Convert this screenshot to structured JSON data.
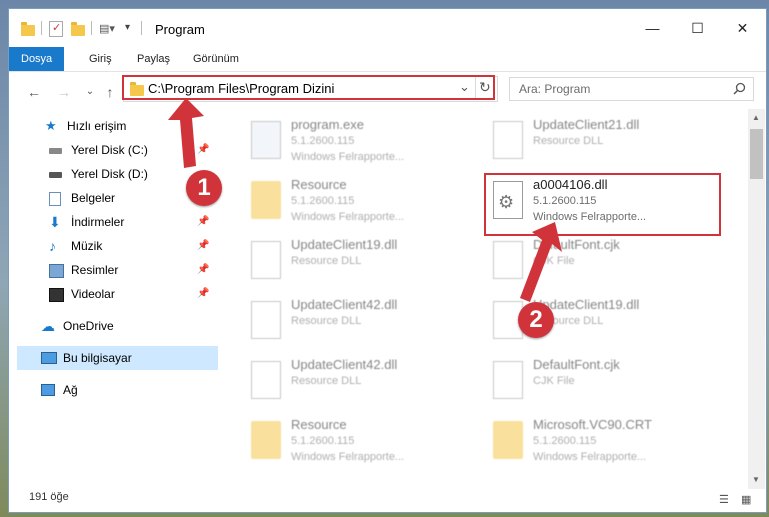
{
  "window": {
    "title": "Program",
    "minimize": "—",
    "maximize": "☐",
    "close": "✕"
  },
  "ribbon": {
    "tabs": [
      "Dosya",
      "Giriş",
      "Paylaş",
      "Görünüm"
    ],
    "active_tab": "Dosya"
  },
  "address": {
    "path": "C:\\Program Files\\Program Dizini",
    "back": "←",
    "forward": "→",
    "dropdown": "⌄",
    "up": "↑",
    "refresh": "↻"
  },
  "search": {
    "placeholder": "Ara: Program",
    "icon": "search-icon"
  },
  "nav": {
    "quick_access": "Hızlı erişim",
    "items": [
      {
        "label": "Yerel Disk (C:)",
        "icon": "drive-icon",
        "pinned": true
      },
      {
        "label": "Yerel Disk (D:)",
        "icon": "drive-icon",
        "pinned": false
      },
      {
        "label": "Belgeler",
        "icon": "documents-icon",
        "pinned": true
      },
      {
        "label": "İndirmeler",
        "icon": "download-icon",
        "pinned": true
      },
      {
        "label": "Müzik",
        "icon": "music-icon",
        "pinned": true
      },
      {
        "label": "Resimler",
        "icon": "pictures-icon",
        "pinned": true
      },
      {
        "label": "Videolar",
        "icon": "videos-icon",
        "pinned": true
      }
    ],
    "onedrive": "OneDrive",
    "this_pc": "Bu bilgisayar",
    "network": "Ağ"
  },
  "files": [
    {
      "name": "program.exe",
      "line1": "5.1.2600.115",
      "line2": "Windows Felrapporte...",
      "kind": "exe"
    },
    {
      "name": "UpdateClient21.dll",
      "line1": "Resource DLL",
      "line2": "",
      "kind": "doc"
    },
    {
      "name": "Resource",
      "line1": "5.1.2600.115",
      "line2": "Windows Felrapporte...",
      "kind": "folder"
    },
    {
      "name": "a0004106.dll",
      "line1": "5.1.2600.115",
      "line2": "Windows Felrapporte...",
      "kind": "dll"
    },
    {
      "name": "UpdateClient19.dll",
      "line1": "Resource DLL",
      "line2": "",
      "kind": "doc"
    },
    {
      "name": "DefaultFont.cjk",
      "line1": "CJK File",
      "line2": "",
      "kind": "doc"
    },
    {
      "name": "UpdateClient42.dll",
      "line1": "Resource DLL",
      "line2": "",
      "kind": "doc"
    },
    {
      "name": "UpdateClient19.dll",
      "line1": "Resource DLL",
      "line2": "",
      "kind": "doc"
    },
    {
      "name": "UpdateClient42.dll",
      "line1": "Resource DLL",
      "line2": "",
      "kind": "doc"
    },
    {
      "name": "DefaultFont.cjk",
      "line1": "CJK File",
      "line2": "",
      "kind": "doc"
    },
    {
      "name": "Resource",
      "line1": "5.1.2600.115",
      "line2": "Windows Felrapporte...",
      "kind": "folder"
    },
    {
      "name": "Microsoft.VC90.CRT",
      "line1": "5.1.2600.115",
      "line2": "Windows Felrapporte...",
      "kind": "folder"
    }
  ],
  "status": {
    "count": "191 öğe"
  },
  "markers": [
    "1",
    "2"
  ],
  "colors": {
    "accent": "#1979ca",
    "highlight": "#d0343a",
    "folder": "#f5c84c",
    "selection": "#cde8ff"
  }
}
